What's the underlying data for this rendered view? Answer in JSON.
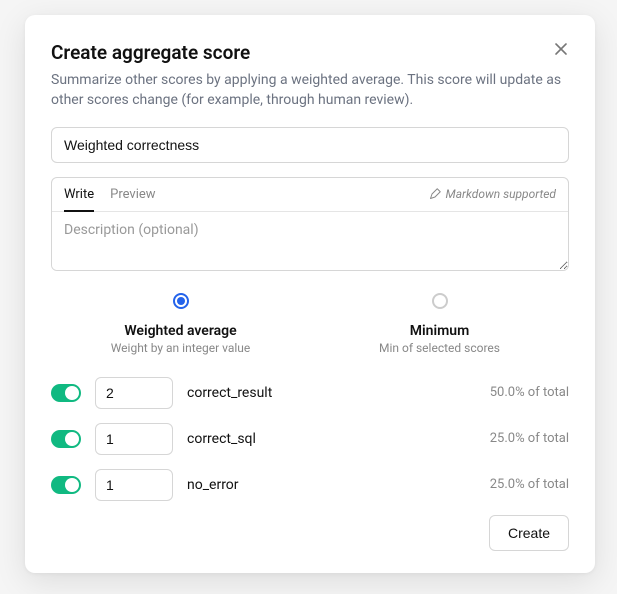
{
  "modal": {
    "title": "Create aggregate score",
    "subtitle": "Summarize other scores by applying a weighted average. This score will update as other scores change (for example, through human review)."
  },
  "name_input": {
    "value": "Weighted correctness"
  },
  "description": {
    "tabs": {
      "write": "Write",
      "preview": "Preview"
    },
    "markdown_label": "Markdown supported",
    "placeholder": "Description (optional)",
    "value": ""
  },
  "methods": [
    {
      "title": "Weighted average",
      "desc": "Weight by an integer value",
      "selected": true
    },
    {
      "title": "Minimum",
      "desc": "Min of selected scores",
      "selected": false
    }
  ],
  "scores": [
    {
      "enabled": true,
      "weight": "2",
      "name": "correct_result",
      "percent": "50.0% of total"
    },
    {
      "enabled": true,
      "weight": "1",
      "name": "correct_sql",
      "percent": "25.0% of total"
    },
    {
      "enabled": true,
      "weight": "1",
      "name": "no_error",
      "percent": "25.0% of total"
    }
  ],
  "footer": {
    "create_label": "Create"
  }
}
